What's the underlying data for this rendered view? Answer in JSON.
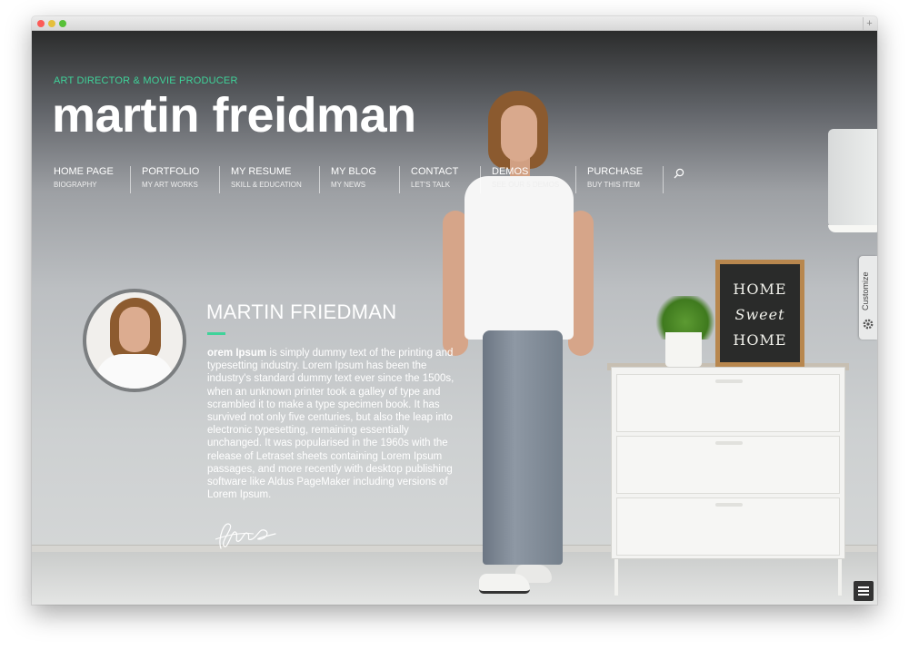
{
  "header": {
    "tagline": "ART DIRECTOR & MOVIE PRODUCER",
    "title": "martin freidman"
  },
  "nav": {
    "items": [
      {
        "label": "HOME PAGE",
        "sub": "BIOGRAPHY"
      },
      {
        "label": "PORTFOLIO",
        "sub": "MY ART WORKS"
      },
      {
        "label": "MY RESUME",
        "sub": "SKILL & EDUCATION"
      },
      {
        "label": "MY BLOG",
        "sub": "MY NEWS"
      },
      {
        "label": "CONTACT",
        "sub": "LET'S TALK"
      },
      {
        "label": "DEMOS",
        "sub": "SEE OUR 5 DEMOS"
      },
      {
        "label": "PURCHASE",
        "sub": "BUY THIS ITEM"
      }
    ],
    "search_icon": "search-icon"
  },
  "profile": {
    "name": "MARTIN FRIEDMAN",
    "bio_lead": "orem Ipsum",
    "bio_text": " is simply dummy text of the printing and typesetting industry. Lorem Ipsum has been the industry's standard dummy text ever since the 1500s, when an unknown printer took a galley of type and scrambled it to make a type specimen book. It has survived not only five centuries, but also the leap into electronic typesetting, remaining essentially unchanged. It was popularised in the 1960s with the release of Letraset sheets containing Lorem Ipsum passages, and more recently with desktop publishing software like Aldus PageMaker including versions of Lorem Ipsum."
  },
  "scene": {
    "chalkboard_lines": [
      "HOME",
      "Sweet",
      "HOME"
    ]
  },
  "customize": {
    "label": "Customize",
    "icon": "gear-icon"
  },
  "colors": {
    "accent": "#3fd39a"
  }
}
